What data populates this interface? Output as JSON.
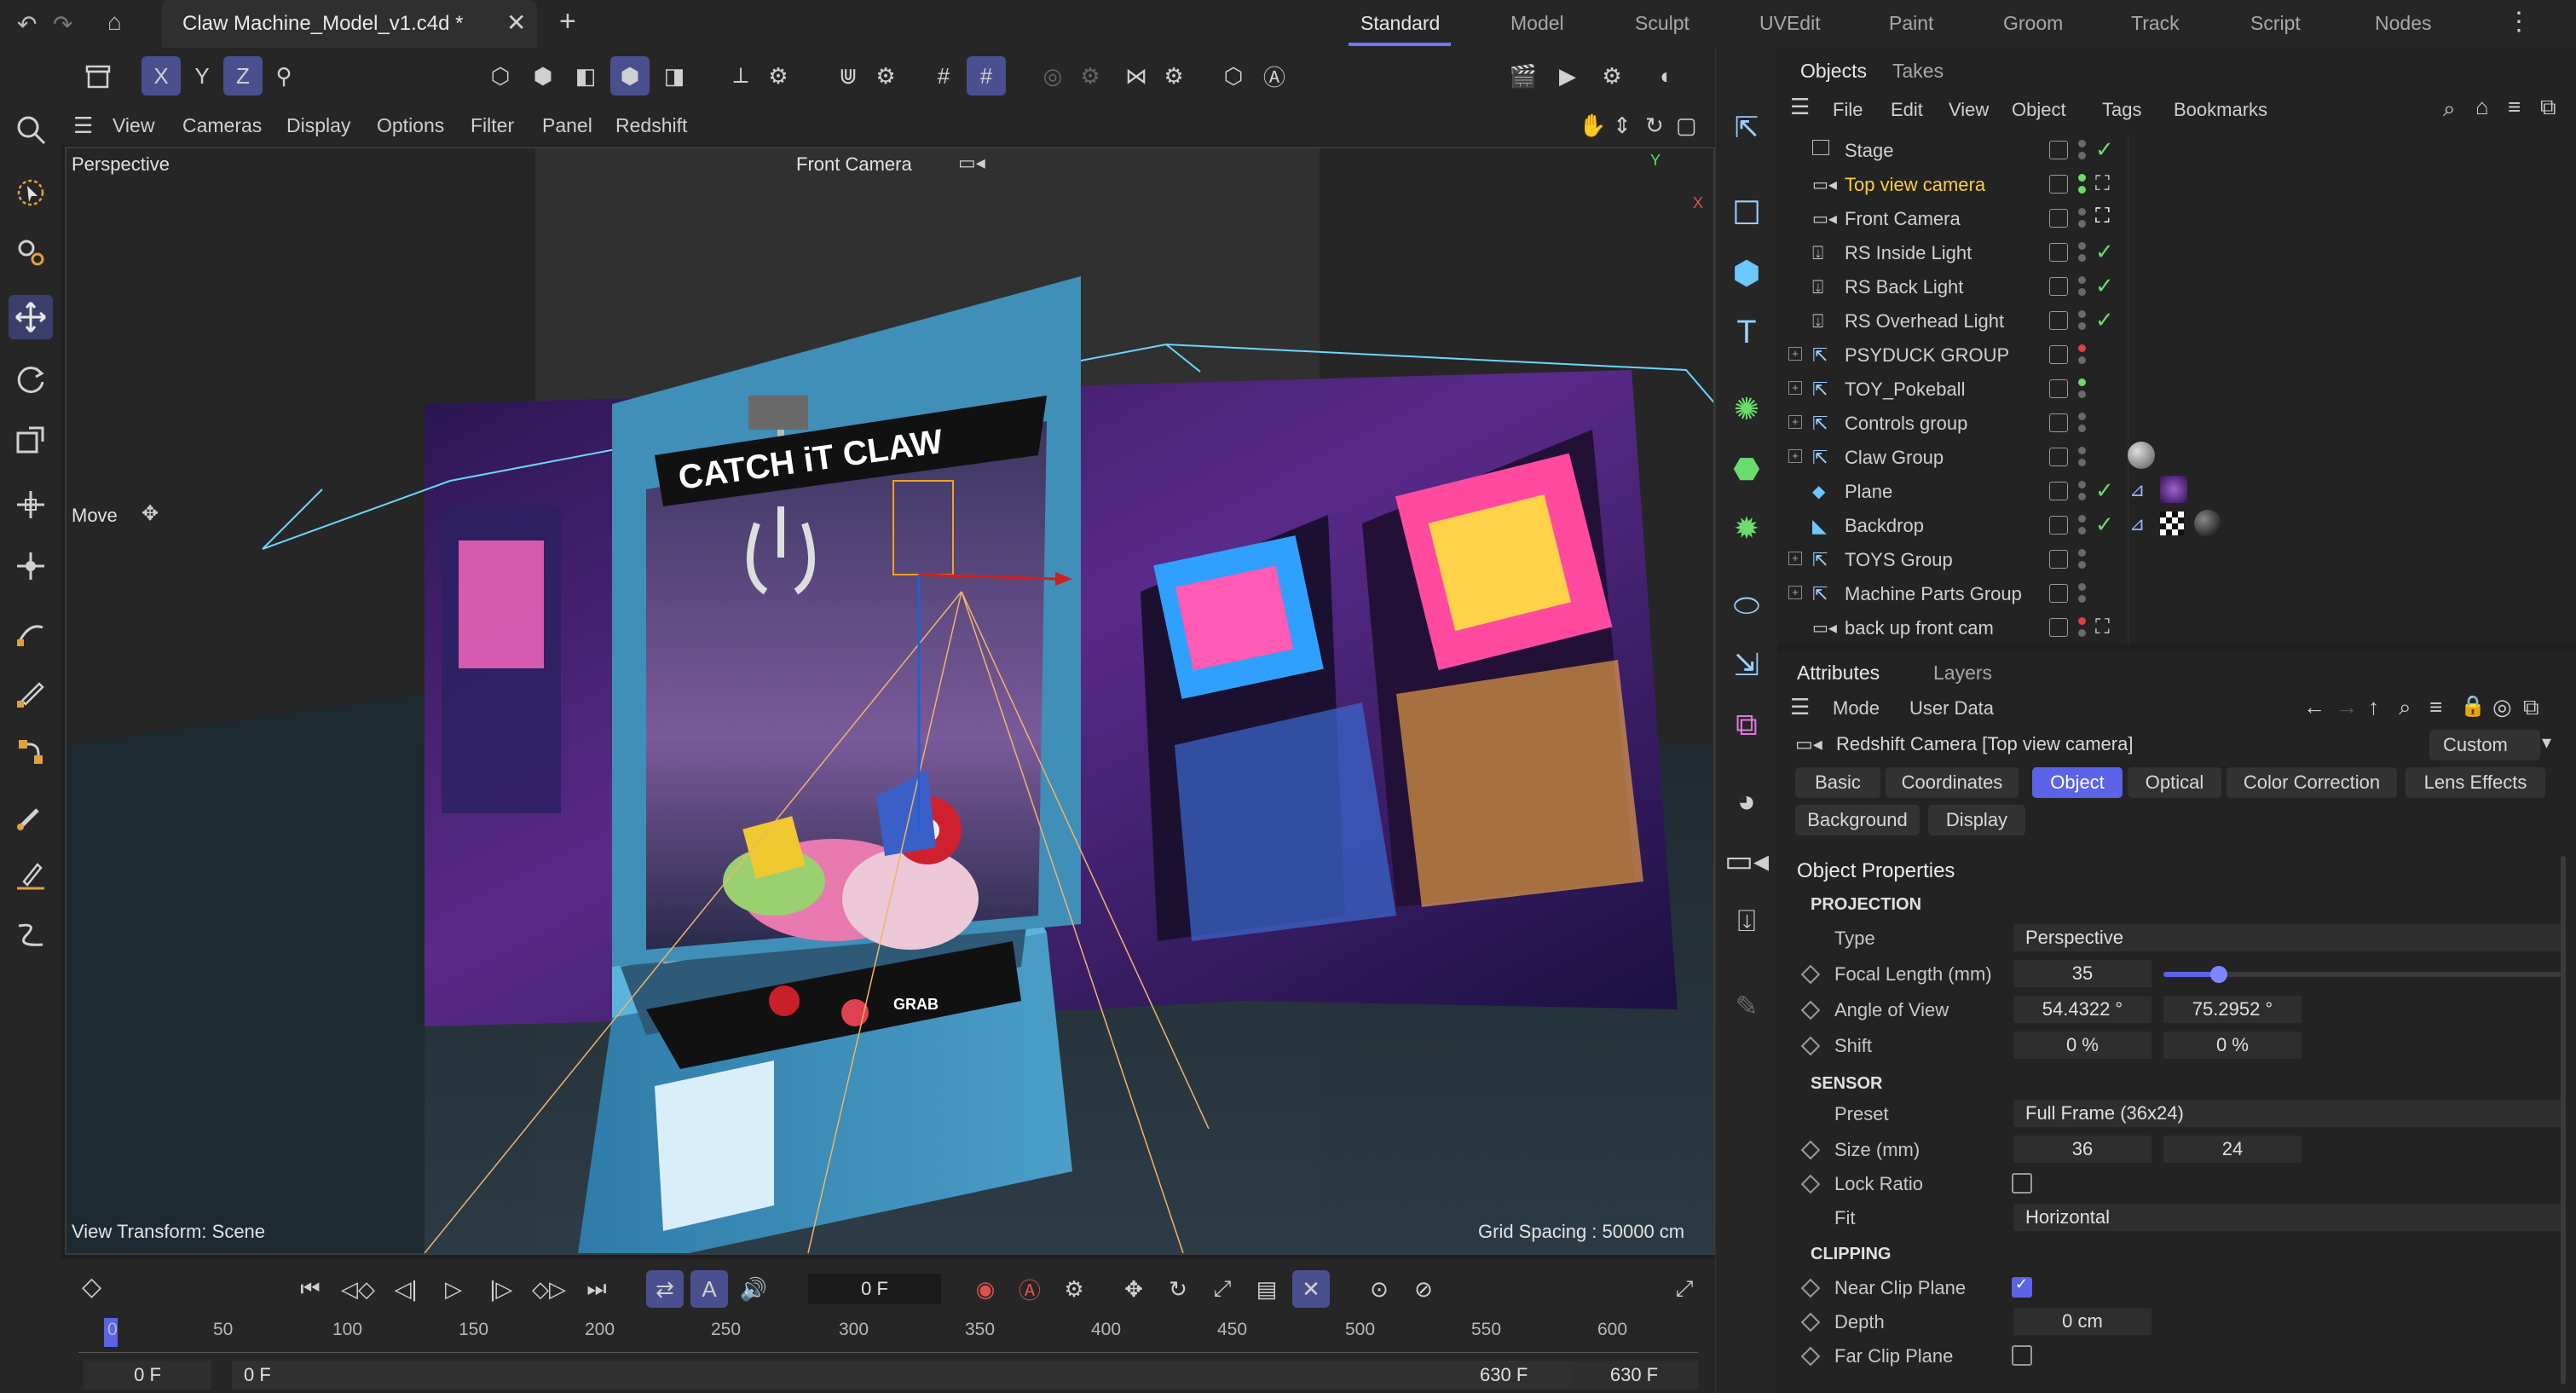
{
  "titlebar": {
    "doc_tab": "Claw Machine_Model_v1.c4d *",
    "layouts": [
      "Standard",
      "Model",
      "Sculpt",
      "UVEdit",
      "Paint",
      "Groom",
      "Track",
      "Script",
      "Nodes"
    ],
    "active_layout": "Standard"
  },
  "viewport_menu": [
    "View",
    "Cameras",
    "Display",
    "Options",
    "Filter",
    "Panel",
    "Redshift"
  ],
  "viewport": {
    "name": "Perspective",
    "camera": "Front Camera",
    "tool": "Move",
    "view_transform": "View Transform: Scene",
    "grid_spacing": "Grid Spacing : 50000 cm",
    "axis_y": "Y",
    "axis_x": "X",
    "sign_line1": "CATCH iT CLAW",
    "grab_label": "GRAB"
  },
  "timeline": {
    "current_frame": "0 F",
    "ruler": [
      "0",
      "50",
      "100",
      "150",
      "200",
      "250",
      "300",
      "350",
      "400",
      "450",
      "500",
      "550",
      "600"
    ],
    "start_field": "0 F",
    "start_field2": "0 F",
    "end_field": "630 F",
    "end_field2": "630 F"
  },
  "objects_panel": {
    "tabs": [
      "Objects",
      "Takes"
    ],
    "menu": [
      "File",
      "Edit",
      "View",
      "Object",
      "Tags",
      "Bookmarks"
    ],
    "rows": [
      {
        "name": "Stage",
        "icon": "stage-icon"
      },
      {
        "name": "Top view camera",
        "icon": "camera-icon",
        "highlight": true
      },
      {
        "name": "Front Camera",
        "icon": "camera-icon"
      },
      {
        "name": "RS Inside Light",
        "icon": "light-icon"
      },
      {
        "name": "RS Back Light",
        "icon": "light-icon"
      },
      {
        "name": "RS Overhead Light",
        "icon": "light-icon"
      },
      {
        "name": "PSYDUCK GROUP",
        "icon": "group-icon"
      },
      {
        "name": "TOY_Pokeball",
        "icon": "group-icon"
      },
      {
        "name": "Controls group",
        "icon": "group-icon"
      },
      {
        "name": "Claw Group",
        "icon": "group-icon"
      },
      {
        "name": "Plane",
        "icon": "plane-icon"
      },
      {
        "name": "Backdrop",
        "icon": "backdrop-icon"
      },
      {
        "name": "TOYS Group",
        "icon": "group-icon"
      },
      {
        "name": "Machine Parts Group",
        "icon": "group-icon"
      },
      {
        "name": "back up front cam",
        "icon": "camera-icon"
      }
    ]
  },
  "attributes_panel": {
    "tabs": [
      "Attributes",
      "Layers"
    ],
    "menu": [
      "Mode",
      "User Data"
    ],
    "object_title": "Redshift Camera [Top view camera]",
    "preset_dropdown": "Custom",
    "tab_buttons_row1": [
      "Basic",
      "Coordinates",
      "Object",
      "Optical",
      "Color Correction",
      "Lens Effects"
    ],
    "tab_buttons_row2": [
      "Background",
      "Display"
    ],
    "active_tab": "Object",
    "section_title": "Object Properties",
    "projection": {
      "heading": "PROJECTION",
      "type_label": "Type",
      "type_value": "Perspective",
      "focal_label": "Focal Length (mm)",
      "focal_value": "35",
      "focal_slider_fraction": 0.14,
      "aov_label": "Angle of View",
      "aov_h": "54.4322 °",
      "aov_v": "75.2952 °",
      "shift_label": "Shift",
      "shift_x": "0 %",
      "shift_y": "0 %"
    },
    "sensor": {
      "heading": "SENSOR",
      "preset_label": "Preset",
      "preset_value": "Full Frame (36x24)",
      "size_label": "Size (mm)",
      "size_w": "36",
      "size_h": "24",
      "lock_label": "Lock Ratio",
      "lock_checked": false,
      "fit_label": "Fit",
      "fit_value": "Horizontal"
    },
    "clipping": {
      "heading": "CLIPPING",
      "near_label": "Near Clip Plane",
      "near_checked": true,
      "depth_label": "Depth",
      "depth_value": "0 cm",
      "far_label": "Far Clip Plane",
      "far_checked": false
    }
  },
  "colors": {
    "accent": "#5b63e6",
    "highlight_text": "#ffcc3d",
    "check_green": "#6bdc6b",
    "machine_blue": "#3f8fb8"
  }
}
